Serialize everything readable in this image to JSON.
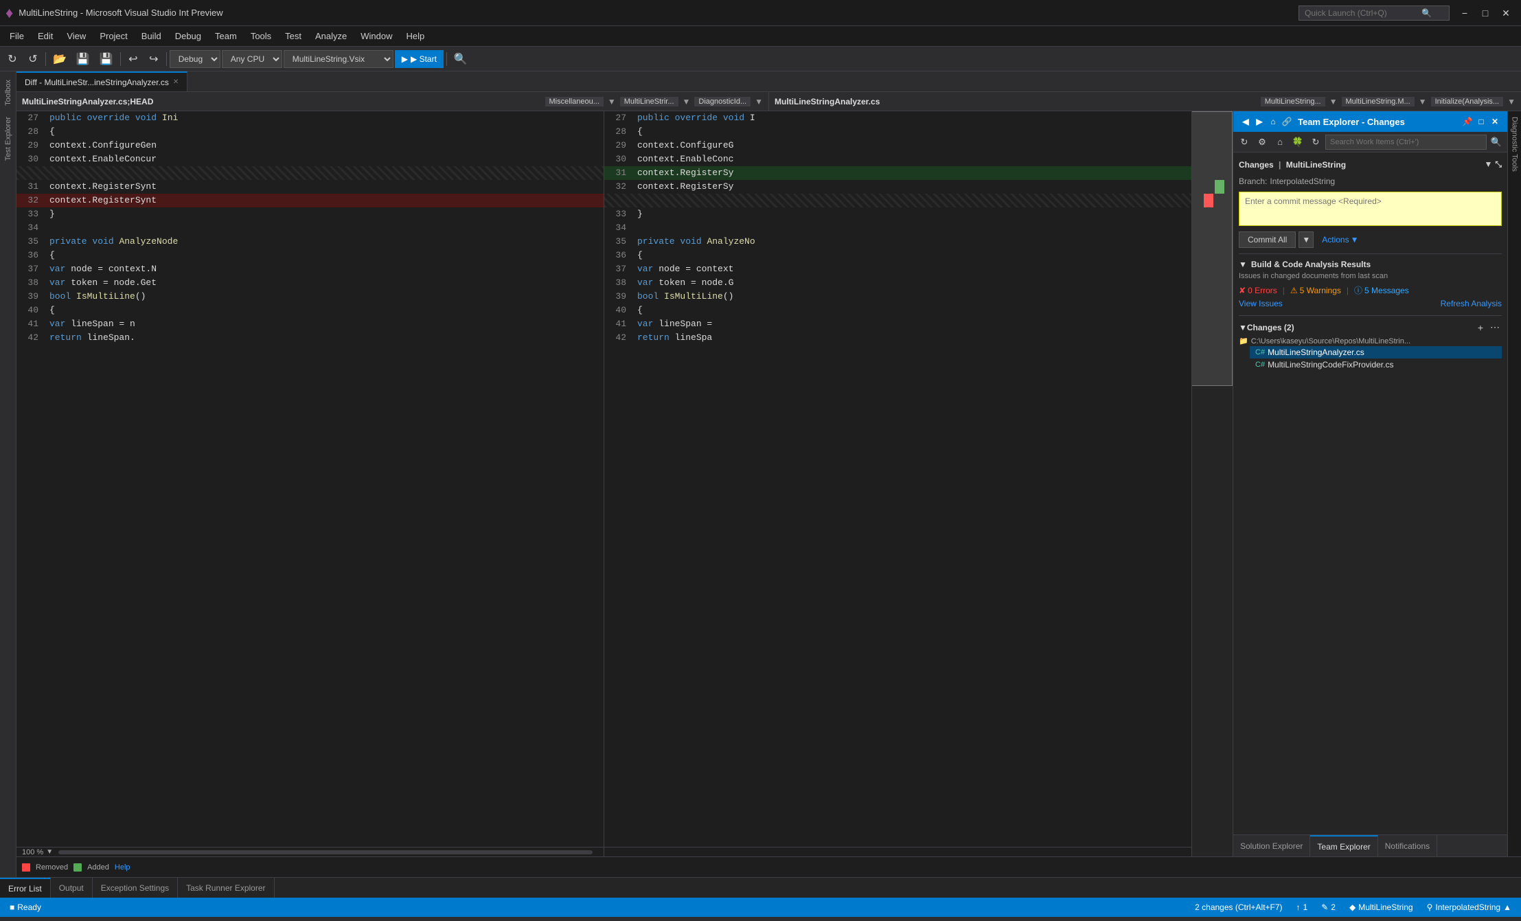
{
  "titleBar": {
    "title": "MultiLineString - Microsoft Visual Studio Int Preview",
    "searchPlaceholder": "Quick Launch (Ctrl+Q)"
  },
  "menuBar": {
    "items": [
      "File",
      "Edit",
      "View",
      "Project",
      "Build",
      "Debug",
      "Team",
      "Tools",
      "Test",
      "Analyze",
      "Window",
      "Help"
    ]
  },
  "toolbar": {
    "buildConfig": "Debug",
    "platform": "Any CPU",
    "solution": "MultiLineString.Vsix",
    "startLabel": "▶ Start"
  },
  "diffTab": {
    "label": "Diff - MultiLineStr...ineStringAnalyzer.cs"
  },
  "leftPane": {
    "fileName": "MultiLineStringAnalyzer.cs;HEAD",
    "breadcrumbs": [
      "Miscellaneou...",
      "MultiLineStrir...",
      "DiagnosticId..."
    ],
    "lines": [
      {
        "num": "27",
        "content": "    public override void Ini",
        "type": "normal",
        "tokens": [
          {
            "t": "kw",
            "v": "public"
          },
          {
            "t": "plain",
            "v": " "
          },
          {
            "t": "kw",
            "v": "override"
          },
          {
            "t": "plain",
            "v": " "
          },
          {
            "t": "kw",
            "v": "void"
          },
          {
            "t": "plain",
            "v": " Ini"
          }
        ]
      },
      {
        "num": "28",
        "content": "    {",
        "type": "normal"
      },
      {
        "num": "29",
        "content": "        context.ConfigureGen",
        "type": "normal"
      },
      {
        "num": "30",
        "content": "        context.EnableConcur",
        "type": "normal"
      },
      {
        "num": "",
        "content": "",
        "type": "hatched"
      },
      {
        "num": "31",
        "content": "        context.RegisterSynt",
        "type": "normal"
      },
      {
        "num": "32",
        "content": "        context.RegisterSynt",
        "type": "removed"
      },
      {
        "num": "33",
        "content": "    }",
        "type": "normal"
      },
      {
        "num": "34",
        "content": "",
        "type": "normal"
      },
      {
        "num": "35",
        "content": "    private void AnalyzeNode",
        "type": "normal"
      },
      {
        "num": "36",
        "content": "    {",
        "type": "normal"
      },
      {
        "num": "37",
        "content": "        var node = context.N",
        "type": "normal"
      },
      {
        "num": "38",
        "content": "        var token = node.Get",
        "type": "normal"
      },
      {
        "num": "39",
        "content": "        bool IsMultiLine()",
        "type": "normal"
      },
      {
        "num": "40",
        "content": "        {",
        "type": "normal"
      },
      {
        "num": "41",
        "content": "            var lineSpan = n",
        "type": "normal"
      },
      {
        "num": "42",
        "content": "            return lineSpan.",
        "type": "normal"
      }
    ]
  },
  "rightPane": {
    "fileName": "MultiLineStringAnalyzer.cs",
    "breadcrumbs": [
      "MultiLineString...",
      "MultiLineString.M...",
      "Initialize(Analysis..."
    ],
    "lines": [
      {
        "num": "27",
        "content": "    public override void I",
        "type": "normal"
      },
      {
        "num": "28",
        "content": "    {",
        "type": "normal"
      },
      {
        "num": "29",
        "content": "        context.ConfigureG",
        "type": "normal"
      },
      {
        "num": "30",
        "content": "        context.EnableConc",
        "type": "normal"
      },
      {
        "num": "31",
        "content": "        context.RegisterSy",
        "type": "added"
      },
      {
        "num": "32",
        "content": "        context.RegisterSy",
        "type": "normal"
      },
      {
        "num": "",
        "content": "",
        "type": "hatched"
      },
      {
        "num": "33",
        "content": "    }",
        "type": "normal"
      },
      {
        "num": "34",
        "content": "",
        "type": "normal"
      },
      {
        "num": "35",
        "content": "    private void AnalyzeNo",
        "type": "normal"
      },
      {
        "num": "36",
        "content": "    {",
        "type": "normal"
      },
      {
        "num": "37",
        "content": "        var node = context",
        "type": "normal"
      },
      {
        "num": "38",
        "content": "        var token = node.G",
        "type": "normal"
      },
      {
        "num": "39",
        "content": "        bool IsMultiLine()",
        "type": "normal"
      },
      {
        "num": "40",
        "content": "        {",
        "type": "normal"
      },
      {
        "num": "41",
        "content": "            var lineSpan =",
        "type": "normal"
      },
      {
        "num": "42",
        "content": "            return lineSpa",
        "type": "normal"
      }
    ]
  },
  "teamExplorer": {
    "title": "Team Explorer - Changes",
    "section": "Changes",
    "repo": "MultiLineString",
    "branchLabel": "Branch:",
    "branch": "InterpolatedString",
    "commitPlaceholder": "Enter a commit message <Required>",
    "commitAllLabel": "Commit All",
    "actionsLabel": "Actions",
    "buildSection": {
      "title": "Build & Code Analysis Results",
      "description": "Issues in changed documents from last scan",
      "errors": "0 Errors",
      "warnings": "5 Warnings",
      "messages": "5 Messages",
      "viewIssuesLabel": "View Issues",
      "refreshLabel": "Refresh Analysis"
    },
    "changesSection": {
      "title": "Changes (2)",
      "rootPath": "C:\\Users\\kaseyu\\Source\\Repos\\MultiLineStrin...",
      "files": [
        {
          "name": "MultiLineStringAnalyzer.cs",
          "selected": true
        },
        {
          "name": "MultiLineStringCodeFixProvider.cs",
          "selected": false
        }
      ]
    }
  },
  "bottomTabs": {
    "items": [
      "Error List",
      "Output",
      "Exception Settings",
      "Task Runner Explorer"
    ]
  },
  "bottomLegend": {
    "removedLabel": "Removed",
    "addedLabel": "Added",
    "helpLabel": "Help"
  },
  "statusBar": {
    "ready": "Ready",
    "upCount": "1",
    "downCount": "2",
    "project": "MultiLineString",
    "branch": "InterpolatedString",
    "changesNote": "2 changes (Ctrl+Alt+F7)"
  },
  "bottomPanelTabs": {
    "items": [
      "Solution Explorer",
      "Team Explorer",
      "Notifications"
    ]
  },
  "leftSidebarTabs": [
    "Toolbox",
    "Test Explorer"
  ],
  "rightSidebarTabs": [
    "Diagnostic Tools"
  ]
}
